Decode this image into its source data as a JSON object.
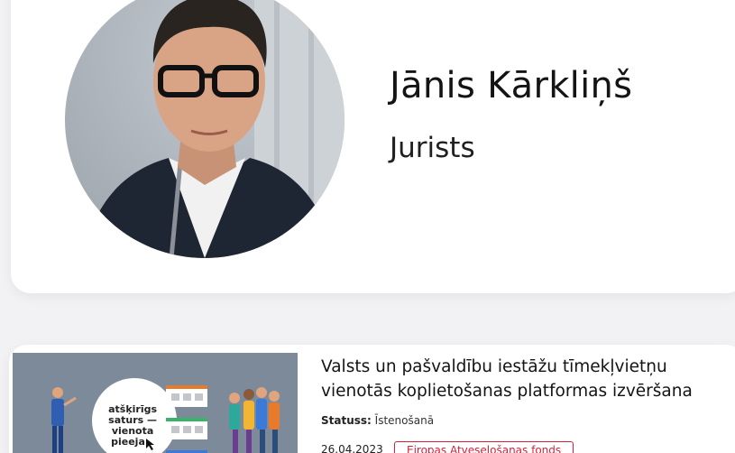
{
  "profile": {
    "name": "Jānis Kārkliņš",
    "role": "Jurists"
  },
  "project": {
    "title": "Valsts un pašvaldību iestāžu tīmekļvietņu vienotās koplietošanas platformas izvēršana",
    "status_label": "Statuss:",
    "status_value": "Īstenošanā",
    "date": "26.04.2023",
    "fund_tag": "Eiropas Atveseļošanas fonds",
    "thumbnail": {
      "bubble_text": "atšķirīgs saturs — vienota pieeja"
    }
  },
  "colors": {
    "accent_red": "#d6203a",
    "thumbnail_bg": "#7d8a99"
  }
}
